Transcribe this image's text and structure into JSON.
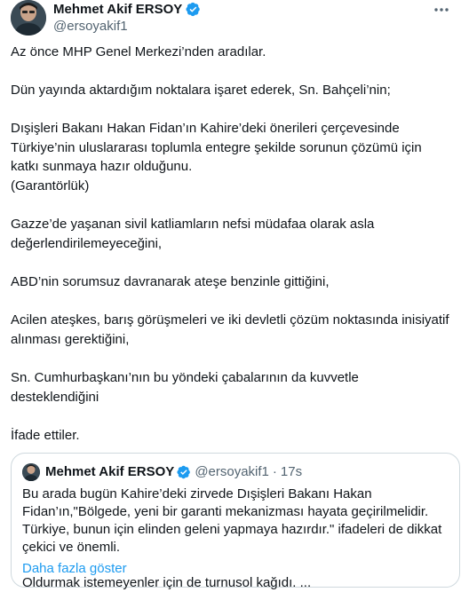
{
  "author": {
    "name": "Mehmet Akif ERSOY",
    "handle": "@ersoyakif1",
    "verified_color": "#1d9bf0"
  },
  "tweet": {
    "paragraphs": [
      "Az önce MHP Genel Merkezi’nden aradılar.",
      "Dün yayında aktardığım noktalara işaret ederek, Sn. Bahçeli’nin;",
      "Dışişleri Bakanı Hakan Fidan’ın Kahire’deki önerileri çerçevesinde Türkiye’nin uluslararası toplumla entegre şekilde sorunun çözümü için katkı sunmaya hazır olduğunu.\n(Garantörlük)",
      "Gazze’de yaşanan sivil katliamların nefsi müdafaa olarak asla değerlendirilemeyeceğini,",
      "ABD’nin sorumsuz davranarak ateşe benzinle gittiğini,",
      "Acilen ateşkes, barış görüşmeleri ve iki devletli çözüm noktasında inisiyatif alınması gerektiğini,",
      "Sn. Cumhurbaşkanı’nın bu yöndeki çabalarının da kuvvetle desteklendiğini",
      "İfade ettiler."
    ]
  },
  "quote": {
    "name": "Mehmet Akif ERSOY",
    "handle": "@ersoyakif1",
    "separator": "·",
    "time": "17s",
    "text": "Bu arada bugün Kahire’deki zirvede Dışişleri Bakanı Hakan Fidan’ın,\"Bölgede, yeni bir garanti mekanizması hayata geçirilmelidir. Türkiye, bunun için elinden geleni yapmaya hazırdır.\" ifadeleri de dikkat çekici ve önemli.\n\nOldurmak istemeyenler için de turnusol kağıdı. ...",
    "show_more": "Daha fazla göster"
  },
  "icons": {
    "verified": "verified-badge-icon",
    "more": "more-horizontal-icon"
  }
}
